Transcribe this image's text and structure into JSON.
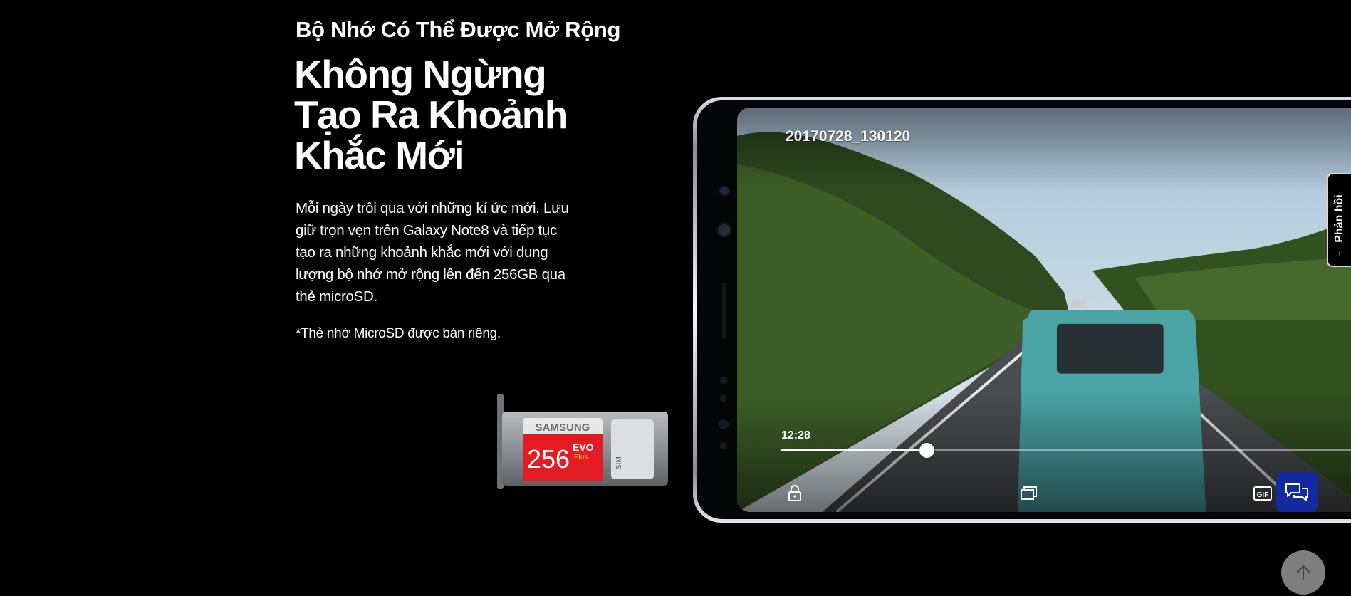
{
  "section": {
    "eyebrow": "Bộ Nhớ Có Thể Được Mở Rộng",
    "headline_lines": [
      "Không Ngừng",
      "Tạo Ra Khoảnh",
      "Khắc Mới"
    ],
    "body_lines": [
      "Mỗi ngày trôi qua với những kí ức mới. Lưu",
      "giữ trọn vẹn trên Galaxy Note8 và tiếp tục",
      "tạo ra những khoảnh khắc mới với dung",
      "lượng bộ nhớ mở rộng lên đến 256GB qua",
      "thẻ microSD."
    ],
    "footnote": "*Thẻ nhớ MicroSD được bán riêng."
  },
  "sim_tray": {
    "card_brand": "SAMSUNG",
    "card_capacity": "256",
    "card_line": "EVO",
    "card_sub": "Plus",
    "sim_label": "SIM",
    "card_color": "#e31b23"
  },
  "video_player": {
    "file_name": "20170728_130120",
    "elapsed_time": "12:28",
    "progress_fraction": 0.25
  },
  "icons": {
    "lock": "lock-icon",
    "popup": "popup-play-icon",
    "gif": "gif-icon",
    "chat": "chat-icon",
    "scroll_top": "arrow-up-icon",
    "feedback_arrow": "arrow-up-icon"
  },
  "feedback": {
    "label": "Phản hồi",
    "arrow": "↑"
  },
  "colors": {
    "background": "#000000",
    "chat_button": "#1428a0",
    "scroll_top": "#8c8c8c"
  }
}
